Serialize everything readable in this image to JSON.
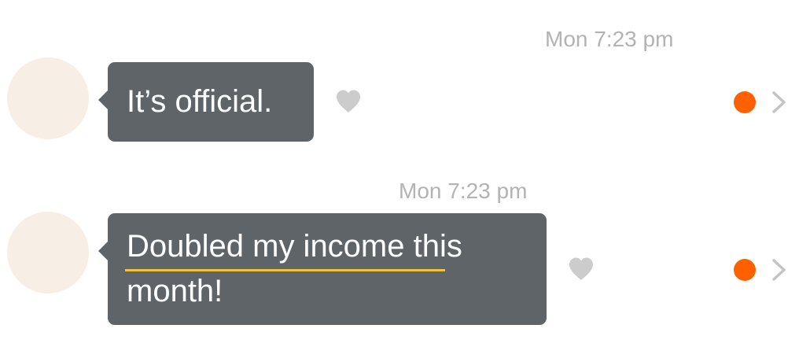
{
  "colors": {
    "bubble_bg": "#5f6469",
    "bubble_text": "#ffffff",
    "avatar_bg": "#f7eee5",
    "timestamp": "#b3b3b3",
    "heart": "#cccccc",
    "status_dot": "#ff6000",
    "chevron": "#c4c4c4",
    "highlight_underline": "#f4c238"
  },
  "messages": [
    {
      "timestamp": "Mon 7:23 pm",
      "text": "It’s official.",
      "icons": [
        "heart-icon",
        "status-dot",
        "chevron-right-icon"
      ]
    },
    {
      "timestamp": "Mon 7:23 pm",
      "text": "Doubled my income this month!",
      "highlighted_text": "Doubled my income",
      "icons": [
        "heart-icon",
        "status-dot",
        "chevron-right-icon"
      ]
    }
  ]
}
